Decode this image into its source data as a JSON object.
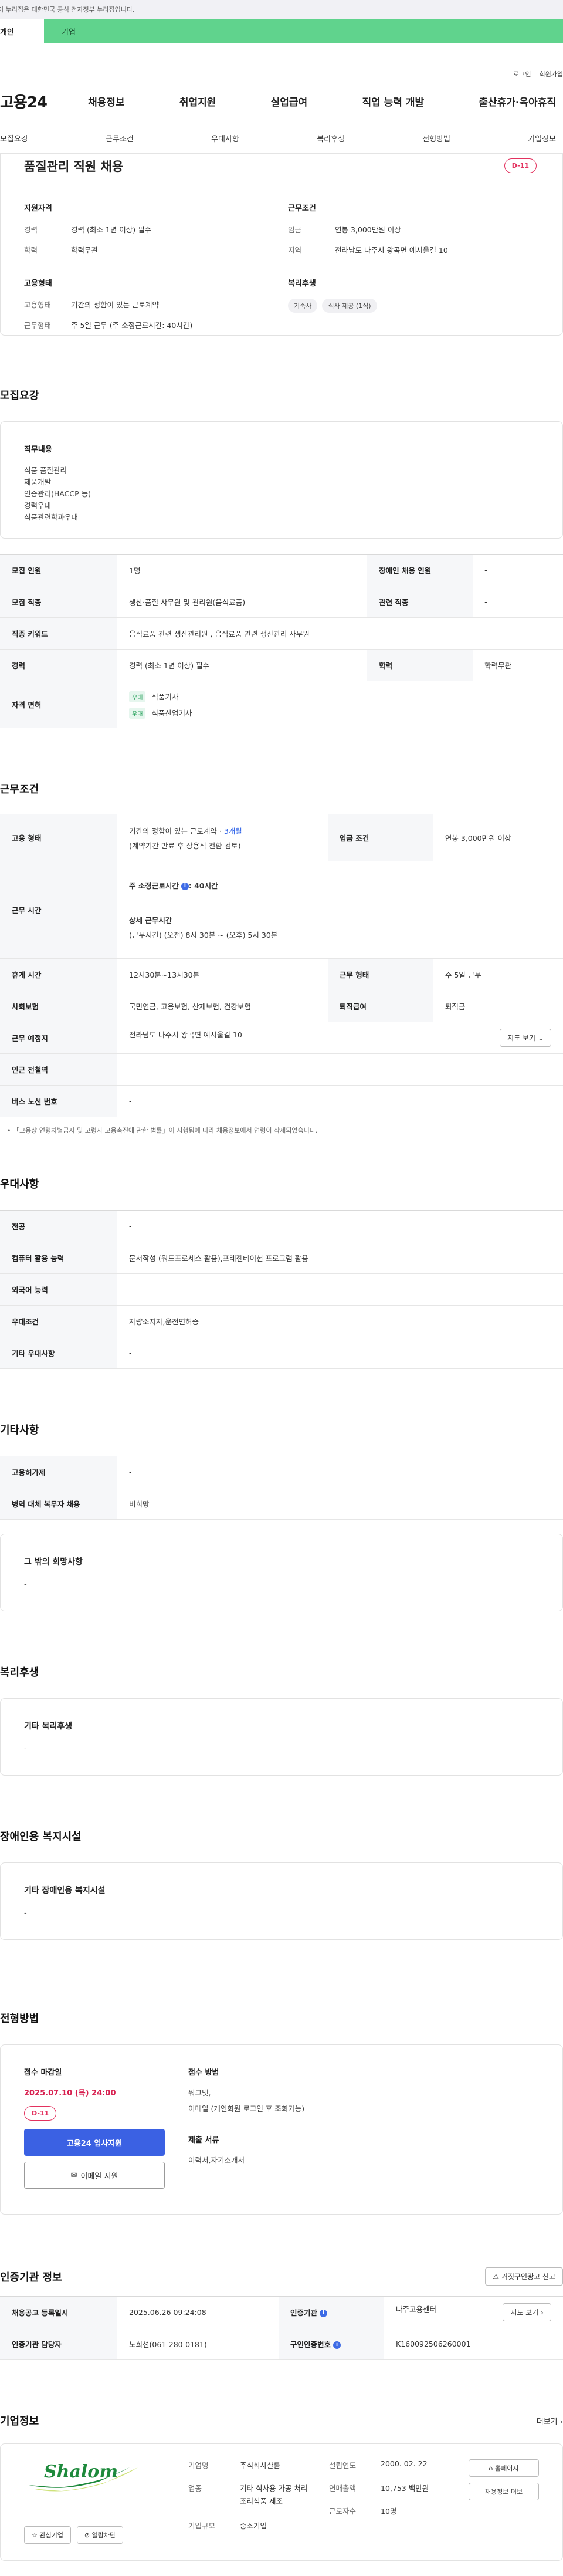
{
  "gov_banner": "이 누리집은 대한민국 공식 전자정부 누리집입니다.",
  "tabs": {
    "individual": "개인",
    "company": "기업"
  },
  "util": {
    "login": "로그인",
    "join": "회원가입"
  },
  "logo": "고용24",
  "gnb": [
    "채용정보",
    "취업지원",
    "실업급여",
    "직업 능력 개발",
    "출산휴가·육아휴직"
  ],
  "subtabs": [
    "모집요강",
    "근무조건",
    "우대사항",
    "복리후생",
    "전형방법",
    "기업정보"
  ],
  "summary": {
    "title": "품질관리 직원 채용",
    "dday": "D-11",
    "qual_head": "지원자격",
    "cond_head": "근무조건",
    "career_k": "경력",
    "career_v": "경력 (최소 1년 이상) 필수",
    "edu_k": "학력",
    "edu_v": "학력무관",
    "wage_k": "임금",
    "wage_v": "연봉 3,000만원 이상",
    "region_k": "지역",
    "region_v": "전라남도 나주시 왕곡면 예시울길 10",
    "emp_head": "고용형태",
    "welfare_head": "복리후생",
    "emptype_k": "고용형태",
    "emptype_v": "기간의 정함이 있는 근로계약",
    "worktype_k": "근무형태",
    "worktype_v": "주 5일 근무 (주 소정근로시간: 40시간)",
    "chips": [
      "기숙사",
      "식사 제공 (1식)"
    ]
  },
  "recruit": {
    "title": "모집요강",
    "duty_head": "직무내용",
    "duty_lines": [
      "식품 품질관리",
      "제품개발",
      "인증관리(HACCP 등)",
      "경력우대",
      "식품관련학과우대"
    ],
    "rows": {
      "count_k": "모집 인원",
      "count_v": "1명",
      "dis_k": "장애인 채용 인원",
      "dis_v": "-",
      "job_k": "모집 직종",
      "job_v": "생산·품질 사무원 및 관리원(음식료품)",
      "rel_k": "관련 직종",
      "rel_v": "-",
      "kw_k": "직종 키워드",
      "kw_v": "음식료품 관련 생산관리원 , 음식료품 관련 생산관리 사무원",
      "career_k": "경력",
      "career_v": "경력 (최소 1년 이상) 필수",
      "edu_k": "학력",
      "edu_v": "학력무관",
      "license_k": "자격 면허",
      "badge": "우대",
      "lic1": "식품기사",
      "lic2": "식품산업기사"
    }
  },
  "conditions": {
    "title": "근무조건",
    "emptype_k": "고용 형태",
    "emptype_v1": "기간의 정함이 있는 근로계약 · ",
    "emptype_months": "3개월",
    "emptype_v2": "(계약기간 만료 후 상용직 전환 검토)",
    "wage_k": "임금 조건",
    "wage_v": "연봉 3,000만원 이상",
    "hours_k": "근무 시간",
    "hours_l1": "주 소정근로시간",
    "hours_l1v": ": 40시간",
    "hours_l2": "상세 근무시간",
    "hours_l3": "(근무시간) (오전) 8시 30분 ~ (오후) 5시 30분",
    "break_k": "휴게 시간",
    "break_v": "12시30분~13시30분",
    "form_k": "근무 형태",
    "form_v": "주 5일 근무",
    "ins_k": "사회보험",
    "ins_v": "국민연금, 고용보험, 산재보험, 건강보험",
    "sev_k": "퇴직급여",
    "sev_v": "퇴직금",
    "place_k": "근무 예정지",
    "place_v": "전라남도 나주시 왕곡면 예시울길 10",
    "map_btn": "지도 보기",
    "sub_k": "인근 전철역",
    "sub_v": "-",
    "bus_k": "버스 노선 번호",
    "bus_v": "-",
    "note": "「고용상 연령차별금지 및 고령자 고용촉진에 관한 법률」이 시행됨에 따라 채용정보에서 연령이 삭제되었습니다."
  },
  "prefer": {
    "title": "우대사항",
    "major_k": "전공",
    "major_v": "-",
    "pc_k": "컴퓨터 활용 능력",
    "pc_v": "문서작성 (워드프로세스 활용),프레젠테이션 프로그램 활용",
    "lang_k": "외국어 능력",
    "lang_v": "-",
    "cond_k": "우대조건",
    "cond_v": "자량소지자,운전면허증",
    "etc_k": "기타 우대사항",
    "etc_v": "-"
  },
  "other": {
    "title": "기타사항",
    "permit_k": "고용허가제",
    "permit_v": "-",
    "mil_k": "병역 대체 복무자 채용",
    "mil_v": "비희망",
    "extra_t": "그 밖의 희망사항",
    "extra_v": "-"
  },
  "welfare": {
    "title": "복리후생",
    "t": "기타 복리후생",
    "v": "-"
  },
  "disabled": {
    "title": "장애인용 복지시설",
    "t": "기타 장애인용 복지시설",
    "v": "-"
  },
  "selection": {
    "title": "전형방법",
    "deadline_t": "접수 마감일",
    "deadline_v": "2025.07.10 (목) 24:00",
    "dday": "D-11",
    "apply_btn": "고용24 입사지원",
    "email_btn": "이메일 지원",
    "method_t": "접수 방법",
    "method_l1": "워크넷,",
    "method_l2": "이메일 (개인회원 로그인 후 조회가능)",
    "docs_t": "제출 서류",
    "docs_v": "이력서,자기소개서"
  },
  "agency": {
    "title": "인증기관 정보",
    "report_btn": "거짓구인광고 신고",
    "reg_k": "채용공고 등록일시",
    "reg_v": "2025.06.26 09:24:08",
    "org_k": "인증기관",
    "org_v": "나주고용센터",
    "map_btn": "지도 보기",
    "mgr_k": "인증기관 담당자",
    "mgr_v": "노희선(061-280-0181)",
    "num_k": "구인인증번호",
    "num_v": "K160092506260001"
  },
  "company": {
    "title": "기업정보",
    "more": "더보기",
    "logo_text": "Shalom",
    "fav_btn": "관심기업",
    "block_btn": "열람차단",
    "name_k": "기업명",
    "name_v": "주식회사샬롬",
    "ind_k": "업종",
    "ind_v": "기타 식사용 가공 처리 조리식품 제조",
    "scale_k": "기업규모",
    "scale_v": "중소기업",
    "est_k": "설립연도",
    "est_v": "2000. 02. 22",
    "rev_k": "연매출액",
    "rev_v": "10,753 백만원",
    "emp_k": "근로자수",
    "emp_v": "10명",
    "home_btn": "홈페이지",
    "info_btn": "채용정보 더보"
  },
  "colors": {
    "accent": "#3b61e3",
    "brand_green": "#60d38d",
    "dday_red": "#e3325f",
    "deadline_red": "#d71f4f"
  }
}
